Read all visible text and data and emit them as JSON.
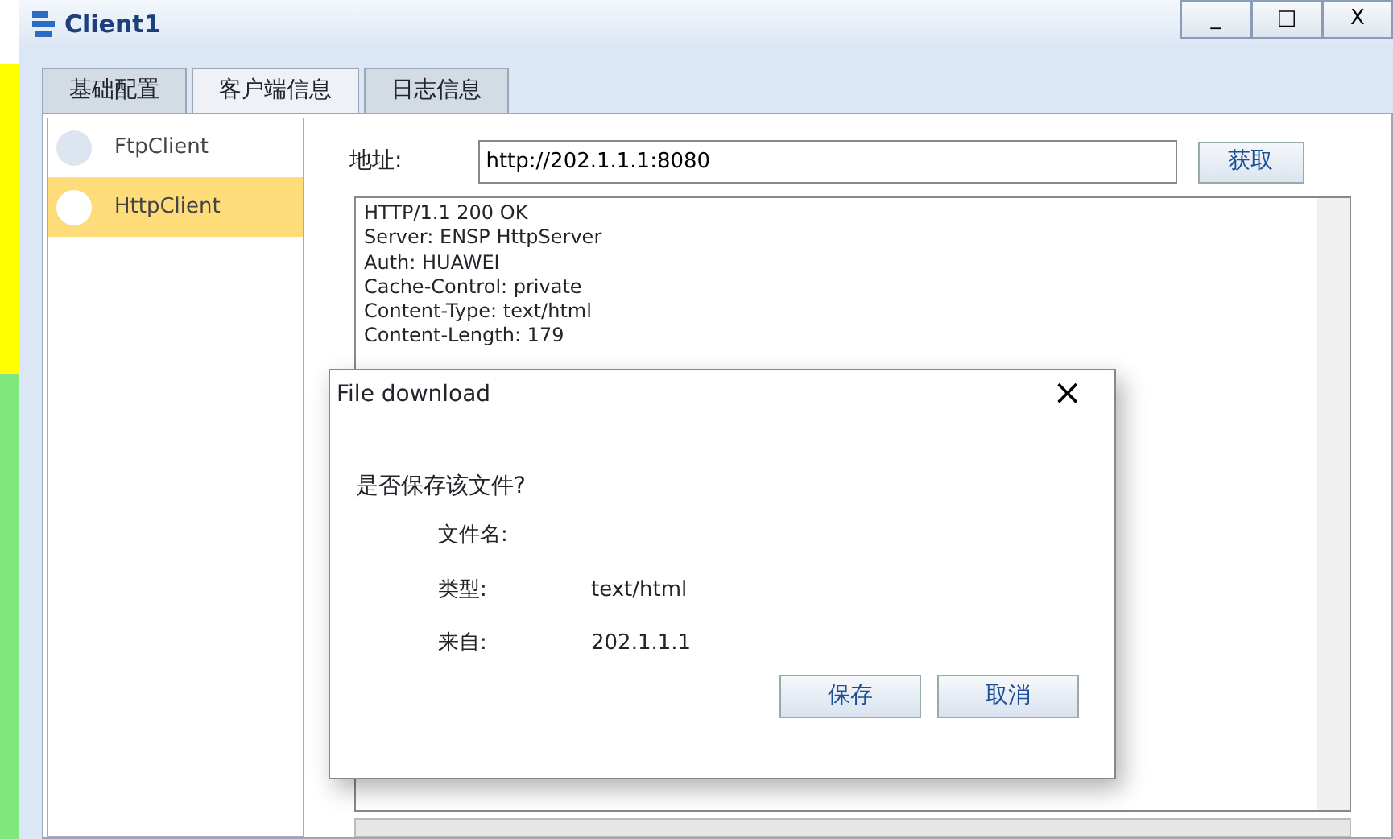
{
  "window": {
    "title": "Client1",
    "controls": [
      "_",
      "□",
      "X"
    ]
  },
  "tabs": [
    {
      "label": "基础配置",
      "selected": false
    },
    {
      "label": "客户端信息",
      "selected": true
    },
    {
      "label": "日志信息",
      "selected": false
    }
  ],
  "sidebar": {
    "items": [
      {
        "label": "FtpClient",
        "selected": false
      },
      {
        "label": "HttpClient",
        "selected": true
      }
    ]
  },
  "address": {
    "label": "地址:",
    "value": "http://202.1.1.1:8080",
    "button": "获取"
  },
  "response": {
    "lines": [
      "HTTP/1.1 200 OK",
      "Server: ENSP HttpServer",
      "Auth: HUAWEI",
      "Cache-Control: private",
      "Content-Type: text/html",
      "Content-Length: 179"
    ]
  },
  "dialog": {
    "title": "File download",
    "close": "×",
    "question": "是否保存该文件?",
    "fields": [
      {
        "label": "文件名:"
      },
      {
        "label": "类型:",
        "value": "text/html"
      },
      {
        "label": "来自:",
        "value": "202.1.1.1"
      }
    ],
    "buttons": [
      "保存",
      "取消"
    ]
  }
}
